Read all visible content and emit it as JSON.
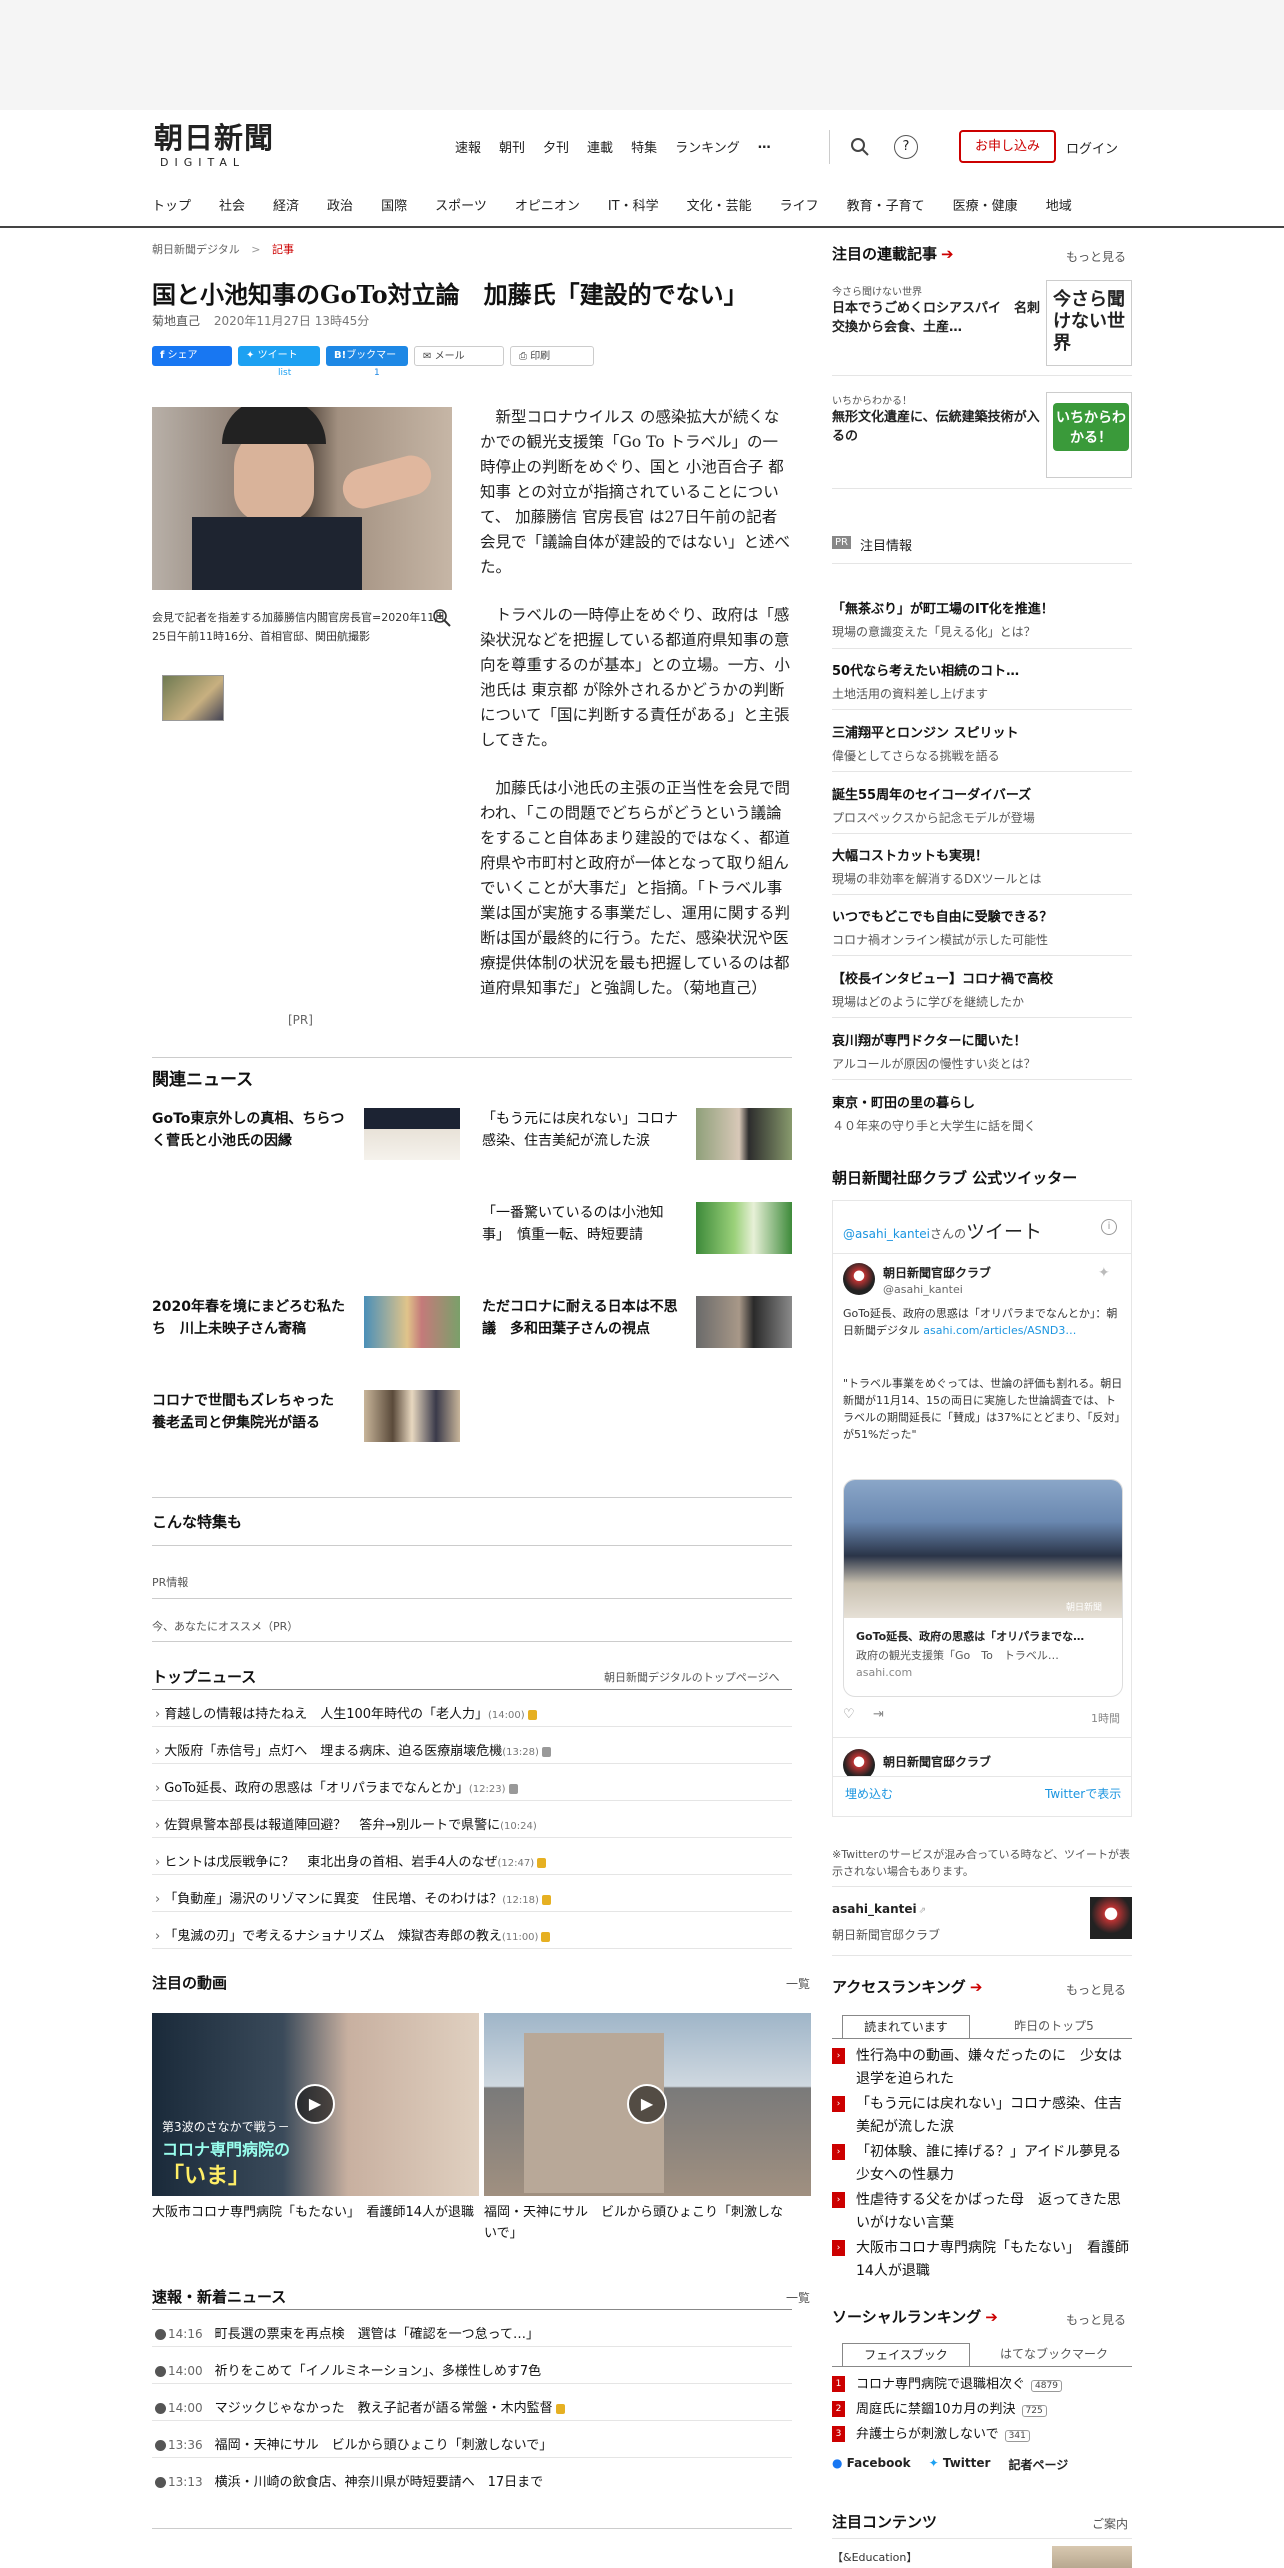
{
  "header": {
    "logo_main": "朝日新聞",
    "logo_sub": "DIGITAL",
    "topnav": [
      "速報",
      "朝刊",
      "夕刊",
      "連載",
      "特集",
      "ランキング"
    ],
    "more_icon": "…",
    "subscribe": "お申し込み",
    "login": "ログイン",
    "catnav": [
      "トップ",
      "社会",
      "経済",
      "政治",
      "国際",
      "スポーツ",
      "オピニオン",
      "IT・科学",
      "文化・芸能",
      "ライフ",
      "教育・子育て",
      "医療・健康",
      "地域"
    ]
  },
  "article": {
    "breadcrumb": [
      "朝日新聞デジタル",
      "記事"
    ],
    "title": "国と小池知事のGoTo対立論　加藤氏「建設的でない」",
    "author": "菊地直己",
    "date": "2020年11月27日 13時45分",
    "share": {
      "facebook": "シェア",
      "tweet": "ツイート",
      "tweet_count": "list",
      "hatena": "ブックマーク",
      "hatena_count": "1",
      "mail": "メール",
      "print": "印刷"
    },
    "caption": "会見で記者を指差する加藤勝信内閣官房長官=2020年11月25日午前11時16分、首相官邸、関田航撮影",
    "pr": "[PR]",
    "paragraphs": [
      "新型コロナウイルス の感染拡大が続くなかでの観光支援策「Go To トラベル」の一時停止の判断をめぐり、国と 小池百合子 都知事 との対立が指摘されていることについて、 加藤勝信 官房長官 は27日午前の記者会見で「議論自体が建設的ではない」と述べた。",
      "トラベルの一時停止をめぐり、政府は「感染状況などを把握している都道府県知事の意向を尊重するのが基本」との立場。一方、小池氏は 東京都 が除外されるかどうかの判断について「国に判断する責任がある」と主張してきた。",
      "加藤氏は小池氏の主張の正当性を会見で問われ、「この問題でどちらがどうという議論をすること自体あまり建設的ではなく、都道府県や市町村と政府が一体となって取り組んでいくことが大事だ」と指摘。「トラベル事業は国が実施する事業だし、運用に関する判断は国が最終的に行う。ただ、感染状況や医療提供体制の状況を最も把握しているのは都道府県知事だ」と強調した。（菊地直己）"
    ]
  },
  "related": {
    "heading": "関連ニュース",
    "items": [
      "GoTo東京外しの真相、ちらつく菅氏と小池氏の因縁",
      "「もう元には戻れない」コロナ感染、住吉美紀が流した涙",
      "「一番驚いているのは小池知事」　慎重一転、時短要請",
      "2020年春を境にまどろむ私たち　川上未映子さん寄稿",
      "ただコロナに耐える日本は不思議　多和田葉子さんの視点",
      "コロナで世間もズレちゃった　養老孟司と伊集院光が語る"
    ]
  },
  "feature": {
    "heading": "こんな特集も",
    "pr1": "PR情報",
    "pr2": "今、あなたにオススメ（PR）"
  },
  "topnews": {
    "heading": "トップニュース",
    "link": "朝日新聞デジタルのトップページへ",
    "items": [
      {
        "t": "育越しの情報は持たねえ　人生100年時代の「老人力」",
        "tm": "(14:00)"
      },
      {
        "t": "大阪府「赤信号」点灯へ　埋まる病床、迫る医療崩壊危機",
        "tm": "(13:28)"
      },
      {
        "t": "GoTo延長、政府の思惑は「オリパラまでなんとか」",
        "tm": "(12:23)"
      },
      {
        "t": "佐賀県警本部長は報道陣回避？　答弁→別ルートで県警に",
        "tm": "(10:24)"
      },
      {
        "t": "ヒントは戊辰戦争に？　東北出身の首相、岩手4人のなぜ",
        "tm": "(12:47)"
      },
      {
        "t": "「負動産」湯沢のリゾマンに異変　住民増、そのわけは？",
        "tm": "(12:18)"
      },
      {
        "t": "「鬼滅の刃」で考えるナショナリズム　煉獄杏寿郎の教え",
        "tm": "(11:00)"
      }
    ]
  },
  "videos": {
    "heading": "注目の動画",
    "more": "一覧",
    "items": [
      "大阪市コロナ専門病院「もたない」　看護師14人が退職",
      "福岡・天神にサル　ビルから頭ひょこり「刺激しないで」"
    ],
    "overlay": [
      "第3波のさなかで戦う－",
      "コロナ専門病院の",
      "「いま」"
    ]
  },
  "breaking": {
    "heading": "速報・新着ニュース",
    "more": "一覧",
    "items": [
      {
        "tm": "14:16",
        "t": "町長選の票束を再点検　選管は「確認を一つ怠って…」"
      },
      {
        "tm": "14:00",
        "t": "祈りをこめて「イノルミネーション」、多様性しめす7色"
      },
      {
        "tm": "14:00",
        "t": "マジックじゃなかった　教え子記者が語る常盤・木内監督"
      },
      {
        "tm": "13:36",
        "t": "福岡・天神にサル　ビルから頭ひょこり「刺激しないで」"
      },
      {
        "tm": "13:13",
        "t": "横浜・川崎の飲食店、神奈川県が時短要請へ　17日まで"
      }
    ]
  },
  "sidebar": {
    "series": {
      "heading": "注目の連載記事",
      "more": "もっと見る",
      "items": [
        {
          "kicker": "今さら聞けない世界",
          "title": "日本でうごめくロシアスパイ　名刺交換から会食、土産…",
          "badge": "今さら聞けない世界"
        },
        {
          "kicker": "いちからわかる！",
          "title": "無形文化遺産に、伝統建築技術が入るの",
          "badge": "いちからわかる！"
        }
      ]
    },
    "pr": {
      "label": "PR",
      "heading": "注目情報",
      "items": [
        {
          "t": "「無茶ぶり」が町工場のIT化を推進！",
          "s": "現場の意識変えた「見える化」とは？"
        },
        {
          "t": "50代なら考えたい相続のコト…",
          "s": "土地活用の資料差し上げます"
        },
        {
          "t": "三浦翔平とロンジン スピリット",
          "s": "偉優としてさらなる挑戦を語る"
        },
        {
          "t": "誕生55周年のセイコーダイバーズ",
          "s": "プロスペックスから記念モデルが登場"
        },
        {
          "t": "大幅コストカットも実現！",
          "s": "現場の非効率を解消するDXツールとは"
        },
        {
          "t": "いつでもどこでも自由に受験できる？",
          "s": "コロナ禍オンライン模試が示した可能性"
        },
        {
          "t": "【校長インタビュー】コロナ禍で高校",
          "s": "現場はどのように学びを継続したか"
        },
        {
          "t": "哀川翔が専門ドクターに聞いた！",
          "s": "アルコールが原因の慢性すい炎とは？"
        },
        {
          "t": "東京・町田の里の暮らし",
          "s": "４０年来の守り手と大学生に話を聞く"
        }
      ]
    },
    "twitter": {
      "heading": "朝日新聞社邸クラブ 公式ツイッター",
      "header_handle": "@asahi_kantei",
      "header_suffix": "さんの",
      "header_word": "ツイート",
      "name": "朝日新聞官邸クラブ",
      "handle": "@asahi_kantei",
      "text": "GoTo延長、政府の思惑は「オリパラまでなんとか」：朝日新聞デジタル",
      "link": "asahi.com/articles/ASND3",
      "ellipsis": "…",
      "quote": "\"トラベル事業をめぐっては、世論の評価も割れる。朝日新聞が11月14、15の両日に実施した世論調査では、トラベルの期間延長に「賛成」は37%にとどまり、「反対」が51%だった\"",
      "card_title": "GoTo延長、政府の思惑は「オリパラまでな…",
      "card_desc": "政府の観光支援策「Go　To　トラベル…",
      "card_src": "asahi.com",
      "time": "1時間",
      "name2": "朝日新聞官邸クラブ",
      "embed": "埋め込む",
      "view": "Twitterで表示",
      "note": "※Twitterのサービスが混み合っている時など、ツイートが表示されない場合もあります。",
      "account_handle": "asahi_kantei",
      "account_name": "朝日新聞官邸クラブ",
      "watermark": "朝日新聞"
    },
    "access": {
      "heading": "アクセスランキング",
      "more": "もっと見る",
      "tabs": [
        "読まれています",
        "昨日のトップ5"
      ],
      "items": [
        "性行為中の動画、嫌々だったのに　少女は退学を迫られた",
        "「もう元には戻れない」コロナ感染、住吉美紀が流した涙",
        "「初体験、誰に捧げる？」アイドル夢見る少女への性暴力",
        "性虐待する父をかばった母　返ってきた思いがけない言葉",
        "大阪市コロナ専門病院「もたない」　看護師14人が退職"
      ]
    },
    "social": {
      "heading": "ソーシャルランキング",
      "more": "もっと見る",
      "tabs": [
        "フェイスブック",
        "はてなブックマーク"
      ],
      "items": [
        {
          "t": "コロナ専門病院で退職相次ぐ",
          "c": "4879"
        },
        {
          "t": "周庭氏に禁錮10カ月の判決",
          "c": "725"
        },
        {
          "t": "弁護士らが刺激しないで",
          "c": "341"
        }
      ],
      "links": [
        "Facebook",
        "Twitter",
        "記者ページ"
      ]
    },
    "contents": {
      "heading": "注目コンテンツ",
      "more": "ご案内",
      "first": "【&Education】"
    }
  },
  "colors": {
    "accent": "#cc0000",
    "twitter": "#1da1f2",
    "link": "#1b95e0"
  }
}
